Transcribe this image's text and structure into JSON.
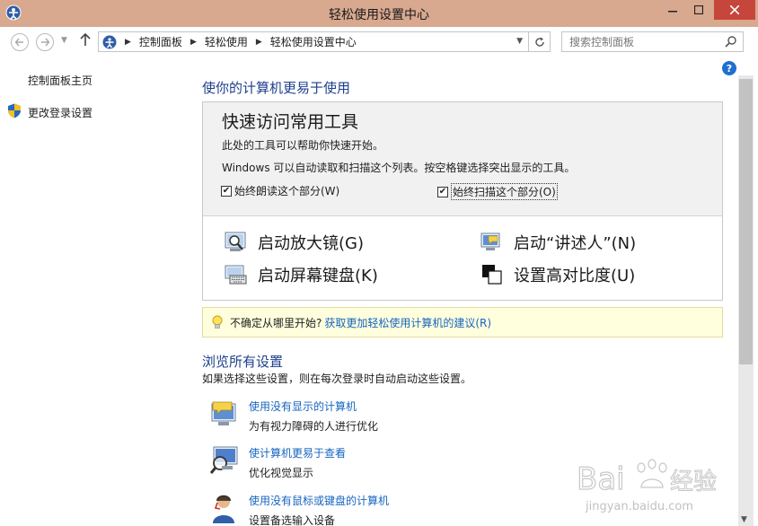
{
  "window": {
    "title": "轻松使用设置中心",
    "colors": {
      "titlebar": "#d8a88f",
      "close": "#c7463b",
      "link": "#1665c0",
      "heading": "#1e3f8c"
    }
  },
  "nav": {
    "breadcrumbs": [
      "控制面板",
      "轻松使用",
      "轻松使用设置中心"
    ],
    "search_placeholder": "搜索控制面板"
  },
  "sidebar": {
    "home": "控制面板主页",
    "change_login": "更改登录设置"
  },
  "main": {
    "heading": "使你的计算机更易于使用",
    "quick": {
      "title": "快速访问常用工具",
      "desc1": "此处的工具可以帮助你快速开始。",
      "desc2": "Windows 可以自动读取和扫描这个列表。按空格键选择突出显示的工具。",
      "checkbox_read": "始终朗读这个部分(W)",
      "checkbox_read_checked": true,
      "checkbox_scan": "始终扫描这个部分(O)",
      "checkbox_scan_checked": true,
      "tools": {
        "magnifier": "启动放大镜(G)",
        "narrator": "启动“讲述人”(N)",
        "osk": "启动屏幕键盘(K)",
        "contrast": "设置高对比度(U)"
      }
    },
    "tip": {
      "text": "不确定从哪里开始?",
      "link": "获取更加轻松使用计算机的建议(R)"
    },
    "browse": {
      "heading": "浏览所有设置",
      "desc": "如果选择这些设置，则在每次登录时自动启动这些设置。",
      "items": [
        {
          "link": "使用没有显示的计算机",
          "desc": "为有视力障碍的人进行优化",
          "icon": "monitor-speech-icon"
        },
        {
          "link": "使计算机更易于查看",
          "desc": "优化视觉显示",
          "icon": "monitor-magnifier-icon"
        },
        {
          "link": "使用没有鼠标或键盘的计算机",
          "desc": "设置备选输入设备",
          "icon": "person-headset-icon"
        }
      ]
    }
  },
  "watermark": {
    "brand": "Bai经验",
    "url": "jingyan.baidu.com"
  }
}
